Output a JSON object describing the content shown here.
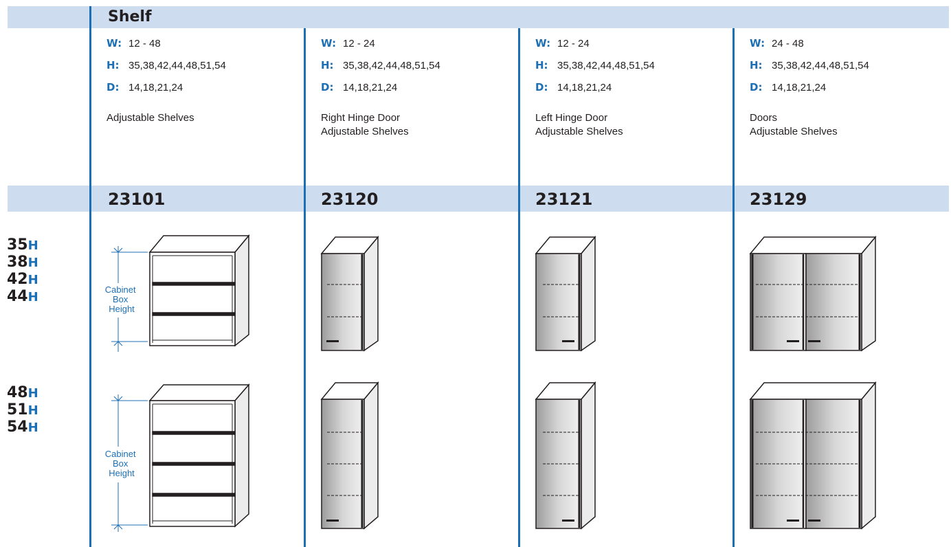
{
  "section": {
    "title": "Shelf"
  },
  "columns": [
    {
      "code": "23101",
      "w_label": "W:",
      "w": "12 - 48",
      "h_label": "H:",
      "h": "35,38,42,44,48,51,54",
      "d_label": "D:",
      "d": "14,18,21,24",
      "desc1": "Adjustable Shelves",
      "desc2": ""
    },
    {
      "code": "23120",
      "w_label": "W:",
      "w": "12 - 24",
      "h_label": "H:",
      "h": "35,38,42,44,48,51,54",
      "d_label": "D:",
      "d": "14,18,21,24",
      "desc1": "Right Hinge Door",
      "desc2": "Adjustable Shelves"
    },
    {
      "code": "23121",
      "w_label": "W:",
      "w": "12 - 24",
      "h_label": "H:",
      "h": "35,38,42,44,48,51,54",
      "d_label": "D:",
      "d": "14,18,21,24",
      "desc1": "Left Hinge Door",
      "desc2": "Adjustable Shelves"
    },
    {
      "code": "23129",
      "w_label": "W:",
      "w": "24 - 48",
      "h_label": "H:",
      "h": "35,38,42,44,48,51,54",
      "d_label": "D:",
      "d": "14,18,21,24",
      "desc1": "Doors",
      "desc2": "Adjustable Shelves"
    }
  ],
  "heights_short": [
    {
      "num": "35",
      "unit": "H"
    },
    {
      "num": "38",
      "unit": "H"
    },
    {
      "num": "42",
      "unit": "H"
    },
    {
      "num": "44",
      "unit": "H"
    }
  ],
  "heights_tall": [
    {
      "num": "48",
      "unit": "H"
    },
    {
      "num": "51",
      "unit": "H"
    },
    {
      "num": "54",
      "unit": "H"
    }
  ],
  "dimension_label": {
    "line1": "Cabinet",
    "line2": "Box",
    "line3": "Height"
  },
  "colors": {
    "accent": "#1c6fb5",
    "band": "#cddcee",
    "text": "#231f20"
  }
}
